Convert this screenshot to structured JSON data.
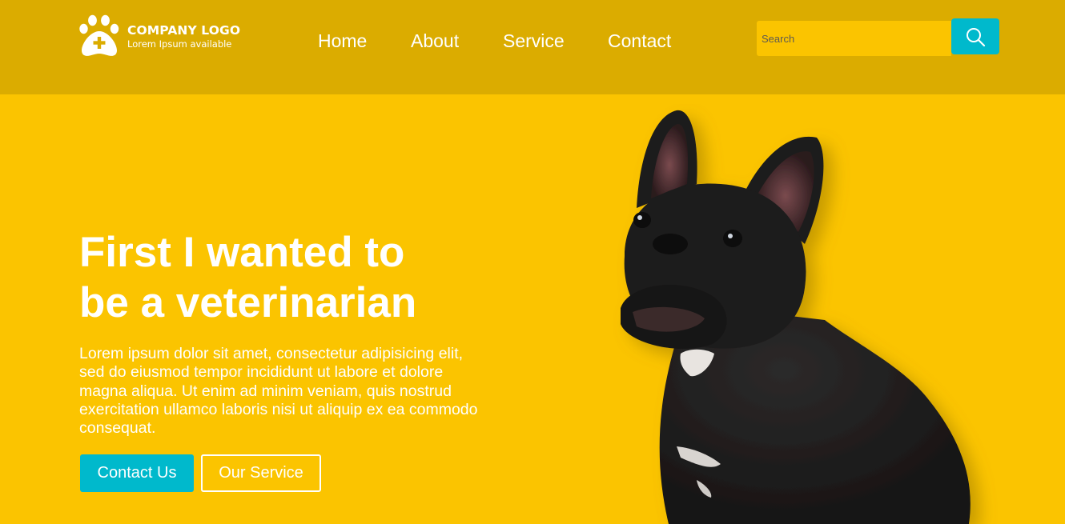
{
  "brand": {
    "title": "COMPANY LOGO",
    "subtitle": "Lorem Ipsum available",
    "icon": "paw-plus-icon"
  },
  "nav": {
    "items": [
      {
        "label": "Home"
      },
      {
        "label": "About"
      },
      {
        "label": "Service"
      },
      {
        "label": "Contact"
      }
    ]
  },
  "search": {
    "placeholder": "Search",
    "value": "",
    "button_icon": "search-icon"
  },
  "hero": {
    "title_line1": "First I wanted to",
    "title_line2": "be a veterinarian",
    "text": "Lorem ipsum dolor sit amet, consectetur adipisicing elit, sed do eiusmod tempor incididunt ut labore et dolore magna aliqua. Ut enim ad minim veniam, quis nostrud exercitation ullamco laboris nisi ut aliquip ex ea commodo consequat.",
    "primary_button": "Contact Us",
    "secondary_button": "Our Service",
    "image": "french-bulldog-photo"
  },
  "colors": {
    "header_bg": "#dbac00",
    "page_bg": "#fbc400",
    "accent": "#00b9cc",
    "text": "#ffffff"
  }
}
